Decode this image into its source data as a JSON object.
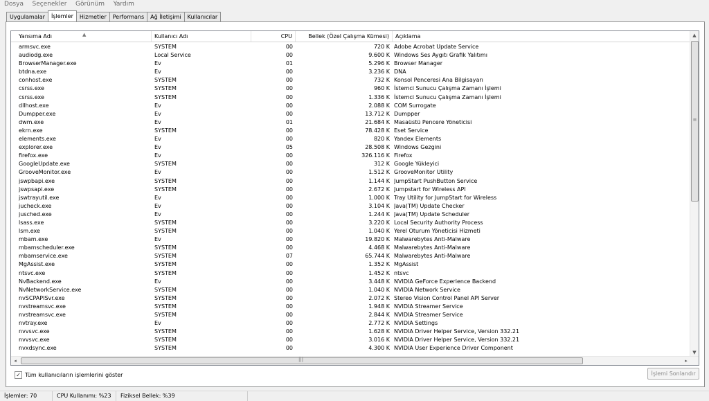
{
  "menu": [
    "Dosya",
    "Seçenekler",
    "Görünüm",
    "Yardım"
  ],
  "tabs": [
    "Uygulamalar",
    "İşlemler",
    "Hizmetler",
    "Performans",
    "Ağ İletişimi",
    "Kullanıcılar"
  ],
  "active_tab": "İşlemler",
  "columns": [
    "Yansıma Adı",
    "Kullanıcı Adı",
    "CPU",
    "Bellek (Özel Çalışma Kümesi)",
    "Açıklama"
  ],
  "rows": [
    [
      "armsvc.exe",
      "SYSTEM",
      "00",
      "720 K",
      "Adobe Acrobat Update Service"
    ],
    [
      "audiodg.exe",
      "Local Service",
      "00",
      "9.600 K",
      "Windows Ses Aygıtı Grafik Yalıtımı"
    ],
    [
      "BrowserManager.exe",
      "Ev",
      "01",
      "5.296 K",
      "Browser Manager"
    ],
    [
      "btdna.exe",
      "Ev",
      "00",
      "3.236 K",
      "DNA"
    ],
    [
      "conhost.exe",
      "SYSTEM",
      "00",
      "732 K",
      "Konsol Penceresi Ana Bilgisayarı"
    ],
    [
      "csrss.exe",
      "SYSTEM",
      "00",
      "960 K",
      "İstemci Sunucu Çalışma Zamanı İşlemi"
    ],
    [
      "csrss.exe",
      "SYSTEM",
      "00",
      "1.336 K",
      "İstemci Sunucu Çalışma Zamanı İşlemi"
    ],
    [
      "dllhost.exe",
      "Ev",
      "00",
      "2.088 K",
      "COM Surrogate"
    ],
    [
      "Dumpper.exe",
      "Ev",
      "00",
      "13.712 K",
      "Dumpper"
    ],
    [
      "dwm.exe",
      "Ev",
      "01",
      "21.684 K",
      "Masaüstü Pencere Yöneticisi"
    ],
    [
      "ekrn.exe",
      "SYSTEM",
      "00",
      "78.428 K",
      "Eset Service"
    ],
    [
      "elements.exe",
      "Ev",
      "00",
      "820 K",
      "Yandex Elements"
    ],
    [
      "explorer.exe",
      "Ev",
      "05",
      "28.508 K",
      "Windows Gezgini"
    ],
    [
      "firefox.exe",
      "Ev",
      "00",
      "326.116 K",
      "Firefox"
    ],
    [
      "GoogleUpdate.exe",
      "SYSTEM",
      "00",
      "312 K",
      "Google Yükleyici"
    ],
    [
      "GrooveMonitor.exe",
      "Ev",
      "00",
      "1.512 K",
      "GrooveMonitor Utility"
    ],
    [
      "jswpbapi.exe",
      "SYSTEM",
      "00",
      "1.144 K",
      "JumpStart PushButton Service"
    ],
    [
      "jswpsapi.exe",
      "SYSTEM",
      "00",
      "2.672 K",
      "Jumpstart for Wireless API"
    ],
    [
      "jswtrayutil.exe",
      "Ev",
      "00",
      "1.000 K",
      "Tray Utility for JumpStart for Wireless"
    ],
    [
      "jucheck.exe",
      "Ev",
      "00",
      "3.104 K",
      "Java(TM) Update Checker"
    ],
    [
      "jusched.exe",
      "Ev",
      "00",
      "1.244 K",
      "Java(TM) Update Scheduler"
    ],
    [
      "lsass.exe",
      "SYSTEM",
      "00",
      "3.220 K",
      "Local Security Authority Process"
    ],
    [
      "lsm.exe",
      "SYSTEM",
      "00",
      "1.040 K",
      "Yerel Oturum Yöneticisi Hizmeti"
    ],
    [
      "mbam.exe",
      "Ev",
      "00",
      "19.820 K",
      "Malwarebytes Anti-Malware"
    ],
    [
      "mbamscheduler.exe",
      "SYSTEM",
      "00",
      "4.468 K",
      "Malwarebytes Anti-Malware"
    ],
    [
      "mbamservice.exe",
      "SYSTEM",
      "07",
      "65.744 K",
      "Malwarebytes Anti-Malware"
    ],
    [
      "MgAssist.exe",
      "SYSTEM",
      "00",
      "1.352 K",
      "MgAssist"
    ],
    [
      "ntsvc.exe",
      "SYSTEM",
      "00",
      "1.452 K",
      "ntsvc"
    ],
    [
      "NvBackend.exe",
      "Ev",
      "00",
      "3.448 K",
      "NVIDIA GeForce Experience Backend"
    ],
    [
      "NvNetworkService.exe",
      "SYSTEM",
      "00",
      "1.040 K",
      "NVIDIA Network Service"
    ],
    [
      "nvSCPAPISvr.exe",
      "SYSTEM",
      "00",
      "2.072 K",
      "Stereo Vision Control Panel API Server"
    ],
    [
      "nvstreamsvc.exe",
      "SYSTEM",
      "00",
      "1.948 K",
      "NVIDIA Streamer Service"
    ],
    [
      "nvstreamsvc.exe",
      "SYSTEM",
      "00",
      "2.844 K",
      "NVIDIA Streamer Service"
    ],
    [
      "nvtray.exe",
      "Ev",
      "00",
      "2.772 K",
      "NVIDIA Settings"
    ],
    [
      "nvvsvc.exe",
      "SYSTEM",
      "00",
      "1.628 K",
      "NVIDIA Driver Helper Service, Version 332.21"
    ],
    [
      "nvvsvc.exe",
      "SYSTEM",
      "00",
      "3.016 K",
      "NVIDIA Driver Helper Service, Version 332.21"
    ],
    [
      "nvxdsync.exe",
      "SYSTEM",
      "00",
      "4.300 K",
      "NVIDIA User Experience Driver Component"
    ]
  ],
  "show_all_users": {
    "label": "Tüm kullanıcıların işlemlerini göster",
    "checked": true
  },
  "end_process_label": "İşlemi Sonlandır",
  "status": {
    "processes": "İşlemler: 70",
    "cpu": "CPU Kullanımı: %23",
    "memory": "Fiziksel Bellek: %39"
  },
  "icons": {
    "sort": "sort-up-arrow-icon",
    "check": "checkmark-icon"
  }
}
